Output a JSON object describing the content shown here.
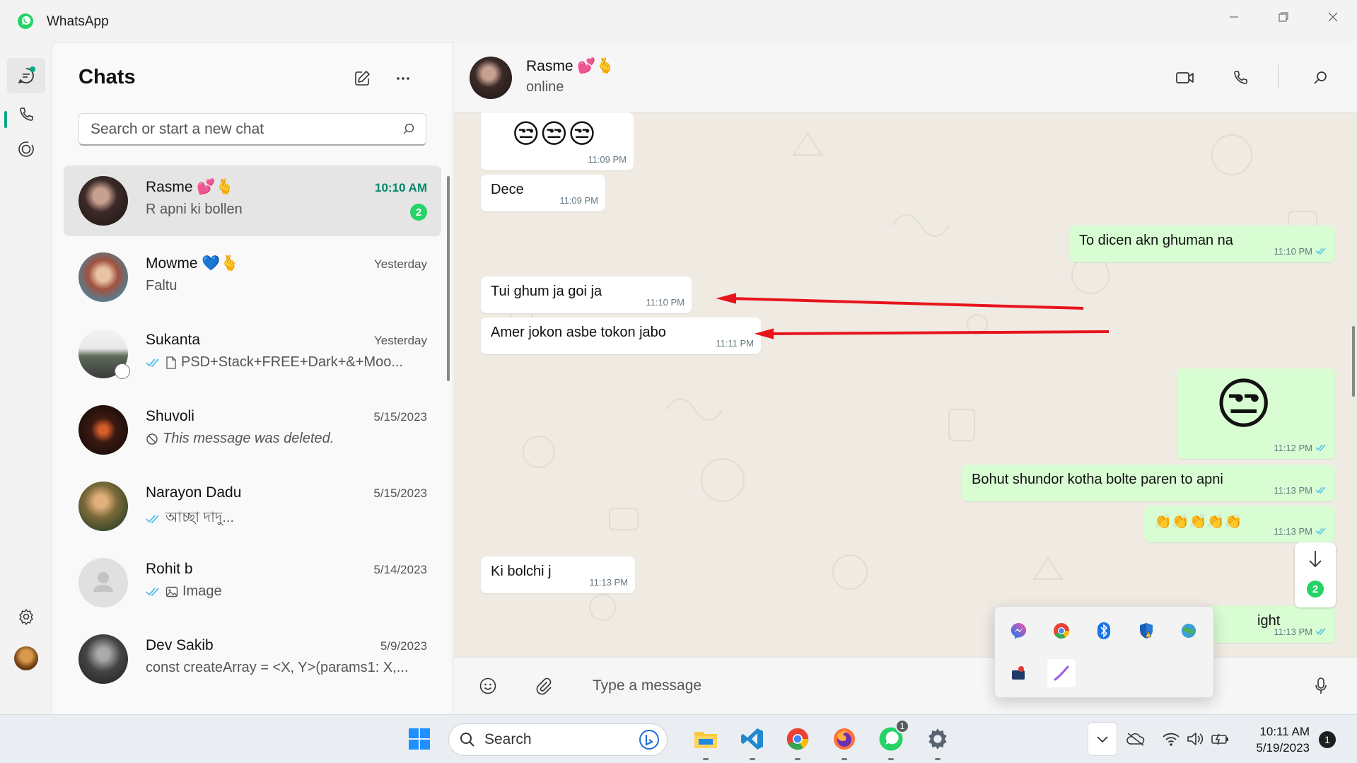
{
  "window": {
    "title": "WhatsApp"
  },
  "sidebar": {
    "title": "Chats",
    "search_placeholder": "Search or start a new chat"
  },
  "chats": [
    {
      "name": "Rasme 💕🫰",
      "time": "10:10 AM",
      "preview": "R apni ki bollen",
      "unread": "2"
    },
    {
      "name": "Mowme 💙🫰",
      "time": "Yesterday",
      "preview": "Faltu"
    },
    {
      "name": "Sukanta",
      "time": "Yesterday",
      "preview": "PSD+Stack+FREE+Dark+&+Moo..."
    },
    {
      "name": "Shuvoli",
      "time": "5/15/2023",
      "preview": "This message was deleted."
    },
    {
      "name": "Narayon Dadu",
      "time": "5/15/2023",
      "preview": "আচ্ছা দাদু..."
    },
    {
      "name": "Rohit b",
      "time": "5/14/2023",
      "preview": "Image"
    },
    {
      "name": "Dev Sakib",
      "time": "5/9/2023",
      "preview": "const createArray = <X, Y>(params1: X,..."
    }
  ],
  "conversation": {
    "name": "Rasme 💕🫰",
    "status": "online",
    "messages": [
      {
        "dir": "in",
        "text": "😒😒😒",
        "time": "11:09 PM"
      },
      {
        "dir": "in",
        "text": "Dece",
        "time": "11:09 PM"
      },
      {
        "dir": "out",
        "text": "To dicen akn ghuman na",
        "time": "11:10 PM"
      },
      {
        "dir": "in",
        "text": "Tui ghum ja goi ja",
        "time": "11:10 PM"
      },
      {
        "dir": "in",
        "text": "Amer jokon asbe tokon jabo",
        "time": "11:11 PM"
      },
      {
        "dir": "out",
        "text": "😒",
        "time": "11:12 PM"
      },
      {
        "dir": "out",
        "text": "Bohut shundor kotha bolte paren to apni",
        "time": "11:13 PM"
      },
      {
        "dir": "out",
        "text": "👏👏👏👏👏",
        "time": "11:13 PM"
      },
      {
        "dir": "in",
        "text": "Ki bolchi j",
        "time": "11:13 PM"
      },
      {
        "dir": "out",
        "text": "ight",
        "time": "11:13 PM"
      }
    ],
    "scroll_unread": "2"
  },
  "composer": {
    "placeholder": "Type a message"
  },
  "taskbar": {
    "search_label": "Search",
    "whatsapp_badge": "1",
    "time": "10:11 AM",
    "date": "5/19/2023",
    "notifications": "1"
  },
  "colors": {
    "accent": "#00a884",
    "unread_green": "#25d366",
    "outgoing_bubble": "#d9fdd3",
    "chat_background": "#efeae2",
    "annotation_arrow": "#e8141b"
  }
}
